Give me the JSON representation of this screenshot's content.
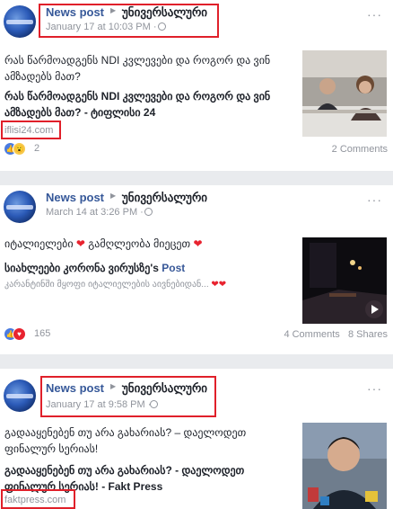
{
  "posts": [
    {
      "page_name": "News post",
      "group": "უნივერსალური",
      "time": "January 17 at 10:03 PM",
      "separator": "·",
      "text": "რას წარმოადგენს NDI კვლევები და როგორ და ვინ ამზადებს მათ?",
      "link_title": "რას წარმოადგენს NDI კვლევები და როგორ და ვინ ამზადებს მათ? - ტიფლისი 24",
      "domain": "iflisi24.com",
      "reaction_count": "2",
      "comments": "2 Comments",
      "reactions": [
        "like-icon",
        "wow-icon"
      ]
    },
    {
      "page_name": "News post",
      "group": "უნივერსალური",
      "time": "March 14 at 3:26 PM",
      "separator": "·",
      "text_before": "იტალიელები",
      "text_middle": "გამღლეობა მიეცეთ",
      "heart": "❤",
      "link_title": "სიახლეები კორონა ვირუსზე's",
      "link_word": "Post",
      "snippet": "კარანტინში მყოფი იტალიელების აივნებიდან...",
      "hearts": "❤❤",
      "reaction_count": "165",
      "comments": "4 Comments",
      "shares": "8 Shares",
      "reactions": [
        "like-icon",
        "love-icon"
      ]
    },
    {
      "page_name": "News post",
      "group": "უნივერსალური",
      "time": "January 17 at 9:58 PM",
      "separator": "·",
      "text": "გადააყენებენ თუ არა გახარიას? – დაელოდეთ ფინალურ სერიას!",
      "link_title": "გადააყენებენ თუ არა გახარიას? - დაელოდეთ ფინალურ სერიას! - Fakt Press",
      "domain": "faktpress.com"
    }
  ],
  "colors": {
    "accent": "#365899",
    "highlight": "#e0202a",
    "like": "#4a7be0",
    "love": "#e8232f"
  }
}
